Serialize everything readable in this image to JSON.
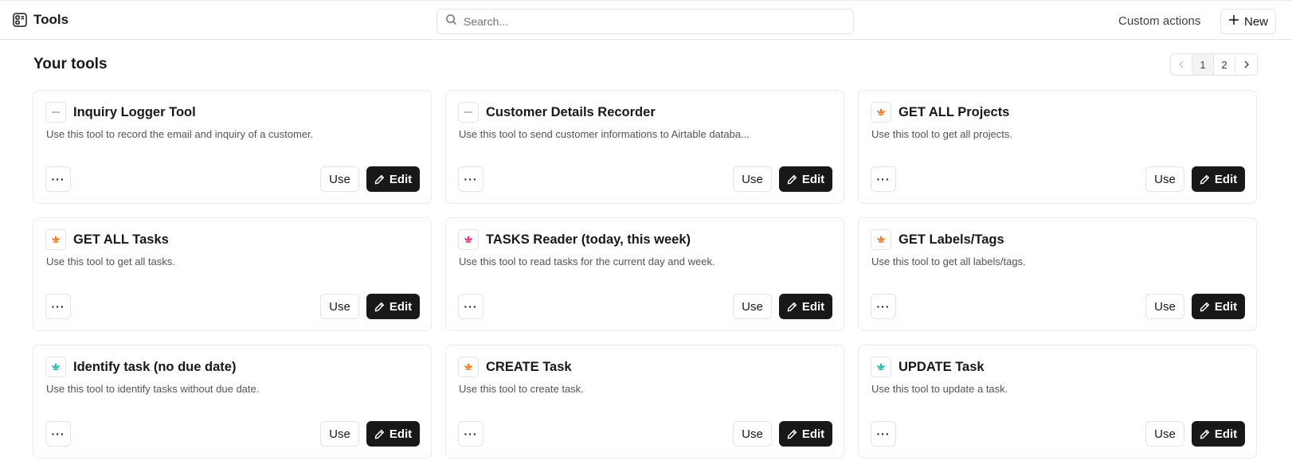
{
  "header": {
    "title": "Tools",
    "search_placeholder": "Search...",
    "custom_actions_label": "Custom actions",
    "new_label": "New"
  },
  "main": {
    "section_title": "Your tools",
    "pagination": {
      "pages": [
        "1",
        "2"
      ],
      "current": "1"
    }
  },
  "buttons": {
    "more": "···",
    "use": "Use",
    "edit": "Edit"
  },
  "colors": {
    "orange": "#f97316",
    "pink": "#db2777",
    "teal": "#14b8a6",
    "gray": "#a1a1aa",
    "primary_dark": "#18181b"
  },
  "tools": [
    {
      "title": "Inquiry Logger Tool",
      "description": "Use this tool to record the email and inquiry of a customer.",
      "icon": "dash-icon",
      "icon_color": "gray"
    },
    {
      "title": "Customer Details Recorder",
      "description": "Use this tool to send customer informations to Airtable databa...",
      "icon": "dash-icon",
      "icon_color": "gray"
    },
    {
      "title": "GET ALL Projects",
      "description": "Use this tool to get all projects.",
      "icon": "lotus-icon",
      "icon_color": "orange"
    },
    {
      "title": "GET ALL Tasks",
      "description": "Use this tool to get all tasks.",
      "icon": "lotus-icon",
      "icon_color": "orange"
    },
    {
      "title": "TASKS Reader (today, this week)",
      "description": "Use this tool to read tasks for the current day and week.",
      "icon": "lotus-icon",
      "icon_color": "pink"
    },
    {
      "title": "GET Labels/Tags",
      "description": "Use this tool to get all labels/tags.",
      "icon": "lotus-icon",
      "icon_color": "orange"
    },
    {
      "title": "Identify task (no due date)",
      "description": "Use this tool to identify tasks without due date.",
      "icon": "lotus-icon",
      "icon_color": "teal"
    },
    {
      "title": "CREATE Task",
      "description": "Use this tool to create task.",
      "icon": "lotus-icon",
      "icon_color": "orange"
    },
    {
      "title": "UPDATE Task",
      "description": "Use this tool to update a task.",
      "icon": "lotus-icon",
      "icon_color": "teal"
    }
  ]
}
